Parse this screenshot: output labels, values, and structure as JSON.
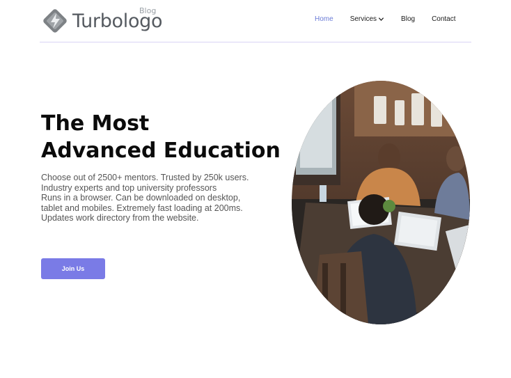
{
  "header": {
    "logo_text": "Turbologo",
    "logo_subtext": "Blog",
    "nav": [
      {
        "label": "Home",
        "active": true
      },
      {
        "label": "Services",
        "has_dropdown": true
      },
      {
        "label": "Blog"
      },
      {
        "label": "Contact"
      }
    ]
  },
  "hero": {
    "title_line1": "The Most",
    "title_line2": "Advanced Education",
    "desc_line1": "Choose out of 2500+ mentors. Trusted by 250k users.",
    "desc_line2": "Industry experts and top university professors",
    "desc_line3": "Runs in a browser. Can be downloaded on desktop, tablet and mobiles. Extremely fast loading at 200ms. Updates work directory from the website.",
    "cta_label": "Join Us"
  },
  "colors": {
    "accent": "#7a7be6",
    "nav_active": "#6a7bd6",
    "divider": "#d9d4f5"
  }
}
